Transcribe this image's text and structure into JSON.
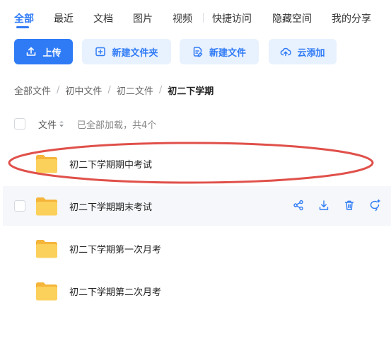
{
  "tabs": [
    {
      "label": "全部",
      "active": true
    },
    {
      "label": "最近",
      "active": false
    },
    {
      "label": "文档",
      "active": false
    },
    {
      "label": "图片",
      "active": false
    },
    {
      "label": "视频",
      "active": false
    },
    {
      "label": "快捷访问",
      "active": false
    },
    {
      "label": "隐藏空间",
      "active": false
    },
    {
      "label": "我的分享",
      "active": false
    }
  ],
  "toolbar": {
    "upload_label": "上传",
    "new_folder_label": "新建文件夹",
    "new_file_label": "新建文件",
    "cloud_add_label": "云添加"
  },
  "breadcrumb": {
    "items": [
      "全部文件",
      "初中文件",
      "初二文件"
    ],
    "separator": "/",
    "current": "初二下学期"
  },
  "list_header": {
    "column_label": "文件",
    "status": "已全部加载，共4个"
  },
  "files": [
    {
      "name": "初二下学期期中考试",
      "type": "folder"
    },
    {
      "name": "初二下学期期末考试",
      "type": "folder"
    },
    {
      "name": "初二下学期第一次月考",
      "type": "folder"
    },
    {
      "name": "初二下学期第二次月考",
      "type": "folder"
    }
  ],
  "row_actions": [
    "share-icon",
    "download-icon",
    "delete-icon",
    "more-icon"
  ],
  "colors": {
    "accent": "#2f7bf6",
    "accent_light": "#e8f1fe",
    "folder": "#f9c74f",
    "annotation": "#e0504a"
  }
}
